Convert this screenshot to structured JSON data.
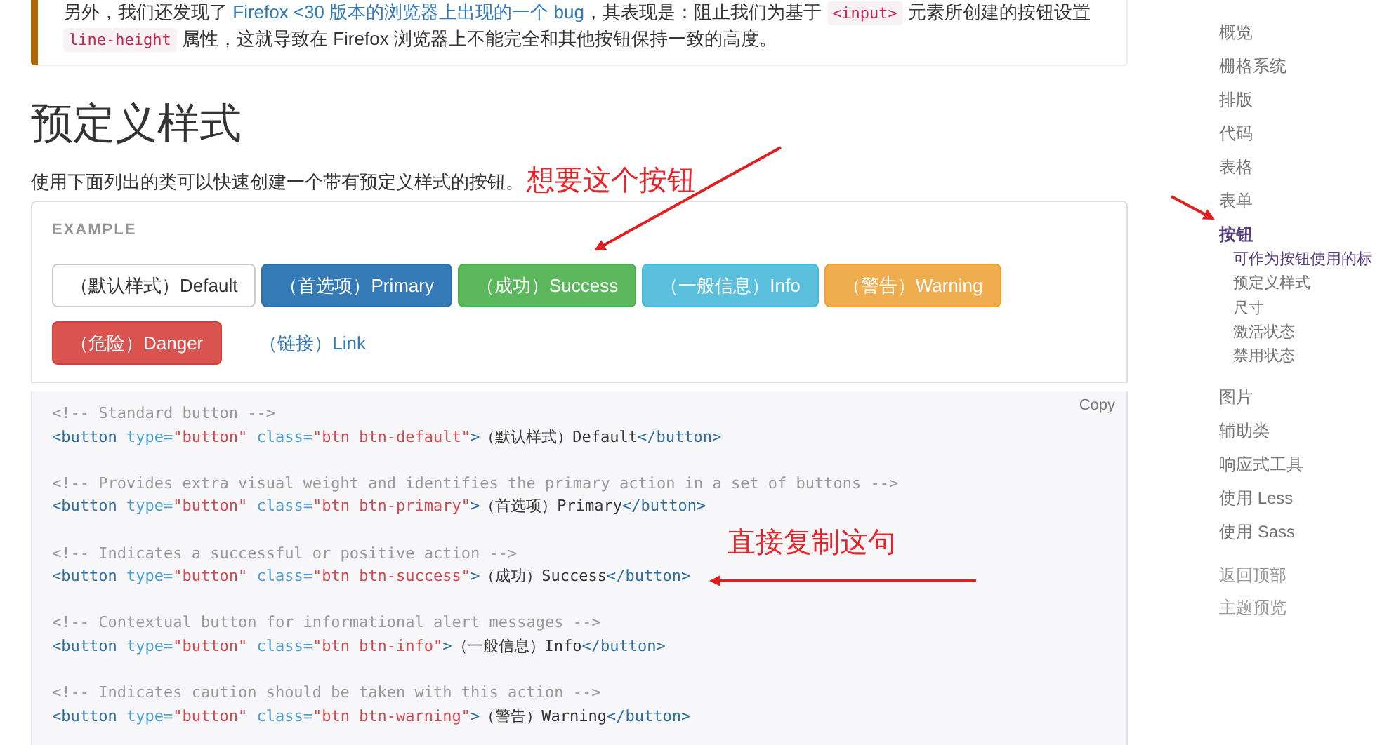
{
  "callout": {
    "lines": [
      [
        {
          "kind": "text",
          "text": "另外，我们还发现了 "
        },
        {
          "kind": "link",
          "text": "Firefox <30 版本的浏览器上出现的一个 bug"
        },
        {
          "kind": "text",
          "text": "，其表现是：阻止我们为基于 "
        },
        {
          "kind": "code",
          "text": "<input>"
        },
        {
          "kind": "text",
          "text": " 元素所创建的按钮设置"
        }
      ],
      [
        {
          "kind": "code",
          "text": "line-height"
        },
        {
          "kind": "text",
          "text": " 属性，这就导致在 Firefox 浏览器上不能完全和其他按钮保持一致的高度。"
        }
      ]
    ]
  },
  "section": {
    "title": "预定义样式",
    "description": "使用下面列出的类可以快速创建一个带有预定义样式的按钮。"
  },
  "annotations": [
    {
      "text": "想要这个按钮"
    },
    {
      "text": "直接复制这句"
    }
  ],
  "example": {
    "label": "EXAMPLE",
    "buttons": [
      {
        "kind": "default",
        "label": "（默认样式）Default"
      },
      {
        "kind": "primary",
        "label": "（首选项）Primary"
      },
      {
        "kind": "success",
        "label": "（成功）Success"
      },
      {
        "kind": "info",
        "label": "（一般信息）Info"
      },
      {
        "kind": "warning",
        "label": "（警告）Warning"
      },
      {
        "kind": "danger",
        "label": "（危险）Danger"
      },
      {
        "kind": "link",
        "label": "（链接）Link"
      }
    ]
  },
  "code_block": {
    "copy_label": "Copy",
    "groups": [
      {
        "comment": "<!-- Standard button -->",
        "code": [
          {
            "kind": "tag",
            "text": "<button"
          },
          {
            "kind": "attr",
            "text": " type="
          },
          {
            "kind": "string",
            "text": "\"button\""
          },
          {
            "kind": "attr",
            "text": " class="
          },
          {
            "kind": "string",
            "text": "\"btn btn-default\""
          },
          {
            "kind": "tag",
            "text": ">"
          },
          {
            "kind": "text",
            "text": "（默认样式）Default"
          },
          {
            "kind": "tag",
            "text": "</button>"
          }
        ]
      },
      {
        "comment": "<!-- Provides extra visual weight and identifies the primary action in a set of buttons -->",
        "code": [
          {
            "kind": "tag",
            "text": "<button"
          },
          {
            "kind": "attr",
            "text": " type="
          },
          {
            "kind": "string",
            "text": "\"button\""
          },
          {
            "kind": "attr",
            "text": " class="
          },
          {
            "kind": "string",
            "text": "\"btn btn-primary\""
          },
          {
            "kind": "tag",
            "text": ">"
          },
          {
            "kind": "text",
            "text": "（首选项）Primary"
          },
          {
            "kind": "tag",
            "text": "</button>"
          }
        ]
      },
      {
        "comment": "<!-- Indicates a successful or positive action -->",
        "code": [
          {
            "kind": "tag",
            "text": "<button"
          },
          {
            "kind": "attr",
            "text": " type="
          },
          {
            "kind": "string",
            "text": "\"button\""
          },
          {
            "kind": "attr",
            "text": " class="
          },
          {
            "kind": "string",
            "text": "\"btn btn-success\""
          },
          {
            "kind": "tag",
            "text": ">"
          },
          {
            "kind": "text",
            "text": "（成功）Success"
          },
          {
            "kind": "tag",
            "text": "</button>"
          }
        ]
      },
      {
        "comment": "<!-- Contextual button for informational alert messages -->",
        "code": [
          {
            "kind": "tag",
            "text": "<button"
          },
          {
            "kind": "attr",
            "text": " type="
          },
          {
            "kind": "string",
            "text": "\"button\""
          },
          {
            "kind": "attr",
            "text": " class="
          },
          {
            "kind": "string",
            "text": "\"btn btn-info\""
          },
          {
            "kind": "tag",
            "text": ">"
          },
          {
            "kind": "text",
            "text": "（一般信息）Info"
          },
          {
            "kind": "tag",
            "text": "</button>"
          }
        ]
      },
      {
        "comment": "<!-- Indicates caution should be taken with this action -->",
        "code": [
          {
            "kind": "tag",
            "text": "<button"
          },
          {
            "kind": "attr",
            "text": " type="
          },
          {
            "kind": "string",
            "text": "\"button\""
          },
          {
            "kind": "attr",
            "text": " class="
          },
          {
            "kind": "string",
            "text": "\"btn btn-warning\""
          },
          {
            "kind": "tag",
            "text": ">"
          },
          {
            "kind": "text",
            "text": "（警告）Warning"
          },
          {
            "kind": "tag",
            "text": "</button>"
          }
        ]
      }
    ]
  },
  "sidebar": {
    "items": [
      {
        "label": "概览",
        "selected": false
      },
      {
        "label": "栅格系统",
        "selected": false
      },
      {
        "label": "排版",
        "selected": false
      },
      {
        "label": "代码",
        "selected": false
      },
      {
        "label": "表格",
        "selected": false
      },
      {
        "label": "表单",
        "selected": false
      },
      {
        "label": "按钮",
        "selected": true,
        "children": [
          {
            "label": "可作为按钮使用的标",
            "selected": true
          },
          {
            "label": "预定义样式",
            "selected": false
          },
          {
            "label": "尺寸",
            "selected": false
          },
          {
            "label": "激活状态",
            "selected": false
          },
          {
            "label": "禁用状态",
            "selected": false
          }
        ]
      },
      {
        "label": "图片",
        "selected": false
      },
      {
        "label": "辅助类",
        "selected": false
      },
      {
        "label": "响应式工具",
        "selected": false
      },
      {
        "label": "使用 Less",
        "selected": false
      },
      {
        "label": "使用 Sass",
        "selected": false
      }
    ],
    "bottom_links": [
      "返回顶部",
      "主题预览"
    ]
  }
}
